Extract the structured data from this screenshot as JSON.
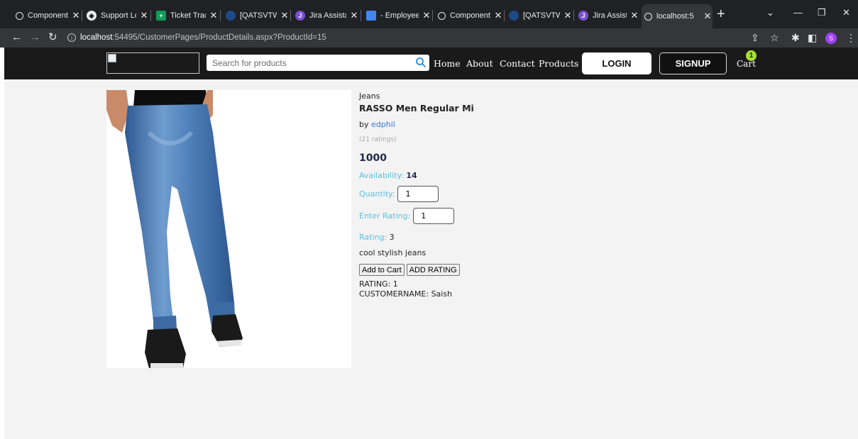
{
  "browser": {
    "tabs": [
      {
        "title": "Component",
        "icon": "globe-icon"
      },
      {
        "title": "Support Lo",
        "icon": "compass-icon"
      },
      {
        "title": "Ticket Track",
        "icon": "sheets-icon"
      },
      {
        "title": "[QATSVTW",
        "icon": "doc-icon"
      },
      {
        "title": "Jira Assistan",
        "icon": "jira-icon"
      },
      {
        "title": "- Employee",
        "icon": "doc-icon"
      },
      {
        "title": "Component",
        "icon": "globe-icon"
      },
      {
        "title": "[QATSVTW",
        "icon": "doc-icon"
      },
      {
        "title": "Jira Assistan",
        "icon": "jira-icon"
      },
      {
        "title": "localhost:5",
        "icon": "globe-icon",
        "active": true
      }
    ],
    "url_host": "localhost",
    "url_rest": ":54495/CustomerPages/ProductDetails.aspx?ProductId=15",
    "profile_initial": "S"
  },
  "navbar": {
    "search_placeholder": "Search for products",
    "links": [
      "Home",
      "About",
      "Contact",
      "Products"
    ],
    "login_label": "LOGIN",
    "signup_label": "SIGNUP",
    "cart_label": "Cart",
    "cart_count": "1"
  },
  "product": {
    "category": "Jeans",
    "title": "RASSO Men Regular Mi",
    "by_prefix": "by",
    "brand": "edphil",
    "ratings_count": "(21 ratings)",
    "price": "1000",
    "availability_label": "Availability:",
    "availability_value": "14",
    "quantity_label": "Quantity:",
    "quantity_value": "1",
    "enter_rating_label": "Enter Rating:",
    "enter_rating_value": "1",
    "rating_label": "Rating:",
    "rating_value": "3",
    "description": "cool stylish jeans",
    "add_to_cart_label": "Add to Cart",
    "add_rating_label": "ADD RATING",
    "review_rating_line": "RATING: 1",
    "review_customer_line": "CUSTOMERNAME: Saish"
  },
  "colors": {
    "navbar_bg": "#1a1a1a",
    "page_bg": "#f3f3f3",
    "label_accent": "#5bc0de",
    "cart_badge": "#a6e22e",
    "link": "#3a7bd5"
  }
}
